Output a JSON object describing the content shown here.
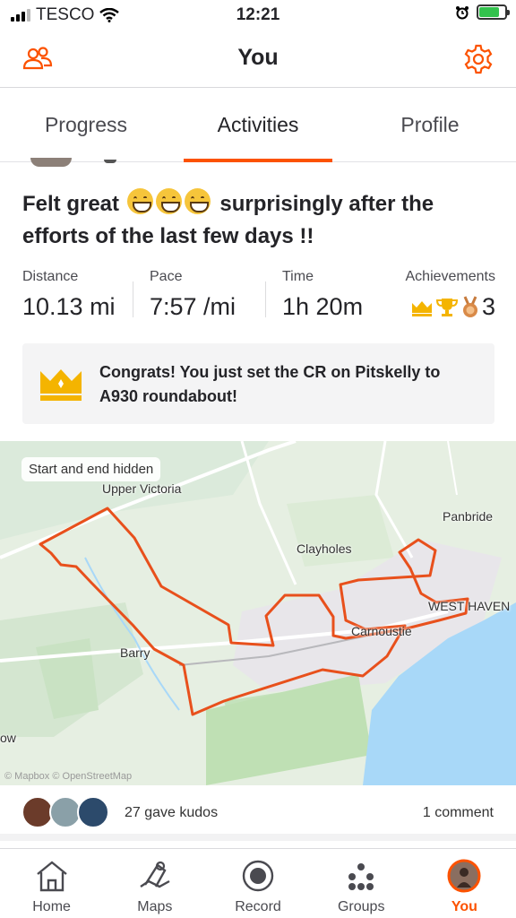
{
  "status_bar": {
    "carrier": "TESCO",
    "time": "12:21"
  },
  "header": {
    "title": "You",
    "left_icon": "friends-icon",
    "right_icon": "gear-icon"
  },
  "tabs": [
    {
      "label": "Progress",
      "active": false
    },
    {
      "label": "Activities",
      "active": true
    },
    {
      "label": "Profile",
      "active": false
    }
  ],
  "activity": {
    "title_part1": "Felt great",
    "title_part2": "surprisingly after the efforts of the last few days !!",
    "stats": {
      "distance_label": "Distance",
      "distance_value": "10.13 mi",
      "pace_label": "Pace",
      "pace_value": "7:57 /mi",
      "time_label": "Time",
      "time_value": "1h 20m",
      "achievements_label": "Achievements",
      "achievements_value": "3"
    },
    "congrats": "Congrats! You just set the CR on Pitskelly to A930 roundabout!",
    "map": {
      "pill": "Start and end hidden",
      "labels": [
        "Upper Victoria",
        "Panbride",
        "Clayholes",
        "WEST HAVEN",
        "Carnoustie",
        "Barry",
        "ow"
      ],
      "attribution": "© Mapbox © OpenStreetMap"
    },
    "kudos_text": "27 gave kudos",
    "comments_text": "1 comment"
  },
  "bottom_nav": [
    {
      "label": "Home",
      "icon": "home-icon",
      "active": false
    },
    {
      "label": "Maps",
      "icon": "maps-icon",
      "active": false
    },
    {
      "label": "Record",
      "icon": "record-icon",
      "active": false
    },
    {
      "label": "Groups",
      "icon": "groups-icon",
      "active": false
    },
    {
      "label": "You",
      "icon": "profile-avatar-icon",
      "active": true
    }
  ],
  "colors": {
    "accent": "#fc5200",
    "route": "#e8501c",
    "sea": "#a8d8f8",
    "crown": "#f4b400"
  }
}
